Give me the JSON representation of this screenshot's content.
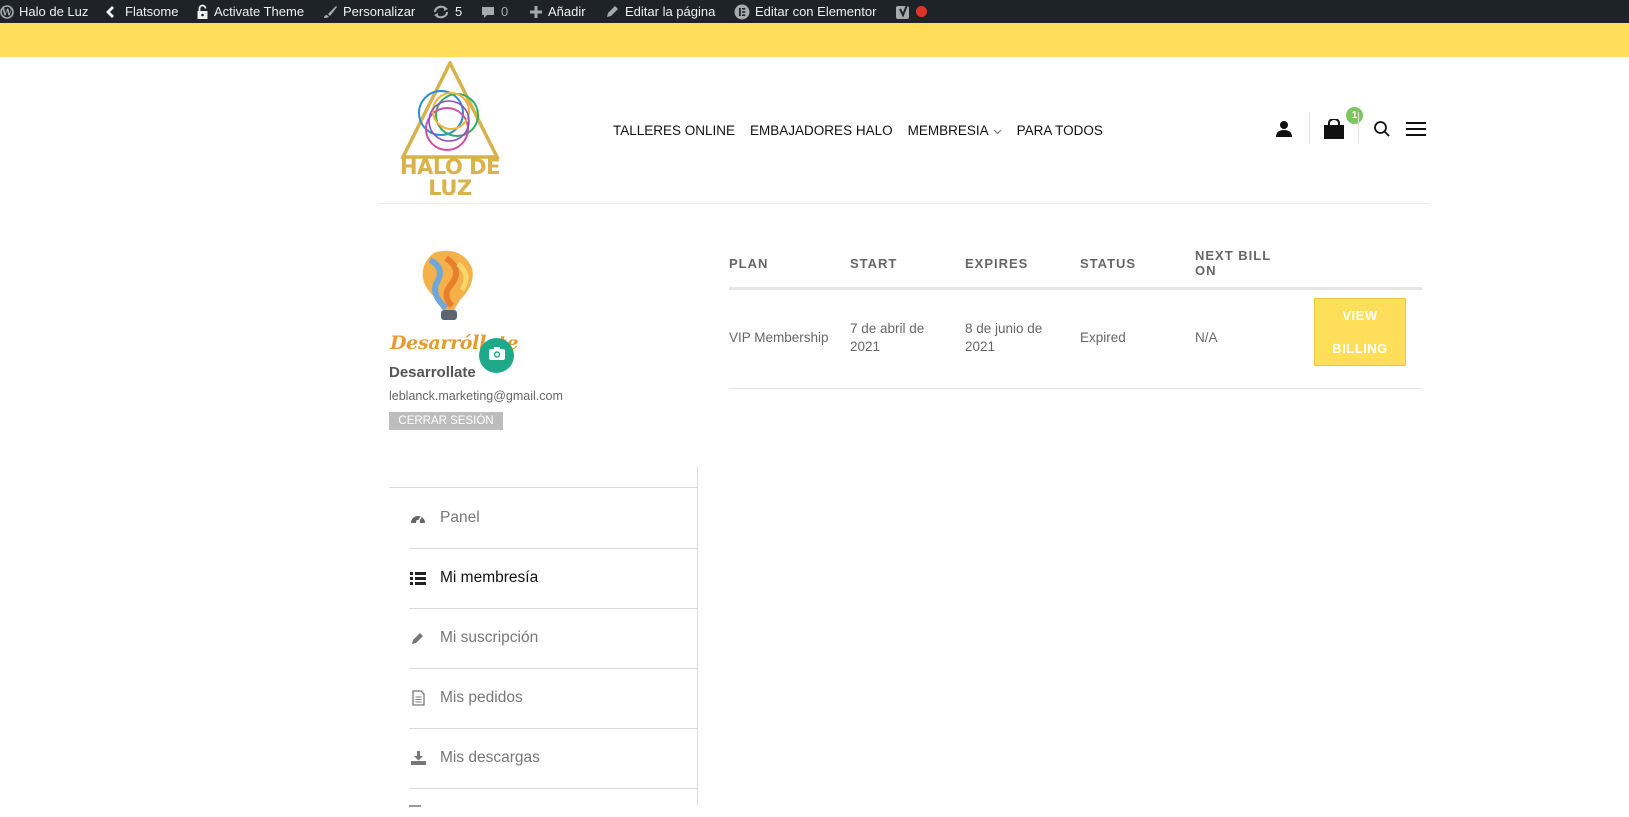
{
  "admin_bar": {
    "site_name": "Halo de Luz",
    "theme": "Flatsome",
    "activate_theme": "Activate Theme",
    "customize": "Personalizar",
    "updates_count": "5",
    "comments_count": "0",
    "add_new": "Añadir",
    "edit_page": "Editar la página",
    "edit_elementor": "Editar con Elementor",
    "icons": [
      "wordpress-icon",
      "flatsome-icon",
      "lock-icon",
      "brush-icon",
      "refresh-icon",
      "comment-icon",
      "plus-icon",
      "pencil-icon",
      "elementor-icon",
      "yoast-icon",
      "status-dot"
    ]
  },
  "header": {
    "logo_text_line1": "HALO DE",
    "logo_text_line2": "LUZ",
    "nav": [
      {
        "label": "TALLERES ONLINE"
      },
      {
        "label": "EMBAJADORES HALO"
      },
      {
        "label": "MEMBRESIA",
        "has_dropdown": true
      },
      {
        "label": "PARA TODOS"
      }
    ],
    "cart_count": "1",
    "icons": [
      "user-icon",
      "cart-icon",
      "search-icon",
      "menu-icon"
    ]
  },
  "profile": {
    "brand_text": "Desarróllate",
    "name": "Desarrollate",
    "email": "leblanck.marketing@gmail.com",
    "logout_label": "CERRAR SESIÓN"
  },
  "account_menu": [
    {
      "label": "Panel",
      "icon": "dashboard-icon",
      "active": false
    },
    {
      "label": "Mi membresía",
      "icon": "list-icon",
      "active": true
    },
    {
      "label": "Mi suscripción",
      "icon": "pencil-icon",
      "active": false
    },
    {
      "label": "Mis pedidos",
      "icon": "document-icon",
      "active": false
    },
    {
      "label": "Mis descargas",
      "icon": "download-icon",
      "active": false
    }
  ],
  "membership_table": {
    "columns": [
      "PLAN",
      "START",
      "EXPIRES",
      "STATUS",
      "NEXT BILL ON"
    ],
    "column_lines": {
      "next_bill_line1": "NEXT BILL",
      "next_bill_line2": "ON"
    },
    "rows": [
      {
        "plan": "VIP Membership",
        "start_line1": "7 de abril de",
        "start_line2": "2021",
        "expires_line1": "8 de junio de",
        "expires_line2": "2021",
        "status": "Expired",
        "next_bill": "N/A",
        "action_line1": "VIEW",
        "action_line2": "BILLING"
      }
    ]
  },
  "colors": {
    "admin_bar": "#1d2327",
    "accent_yellow": "#ffdf5a",
    "camera_green": "#1fa98a",
    "badge_green": "#7ac75e"
  }
}
